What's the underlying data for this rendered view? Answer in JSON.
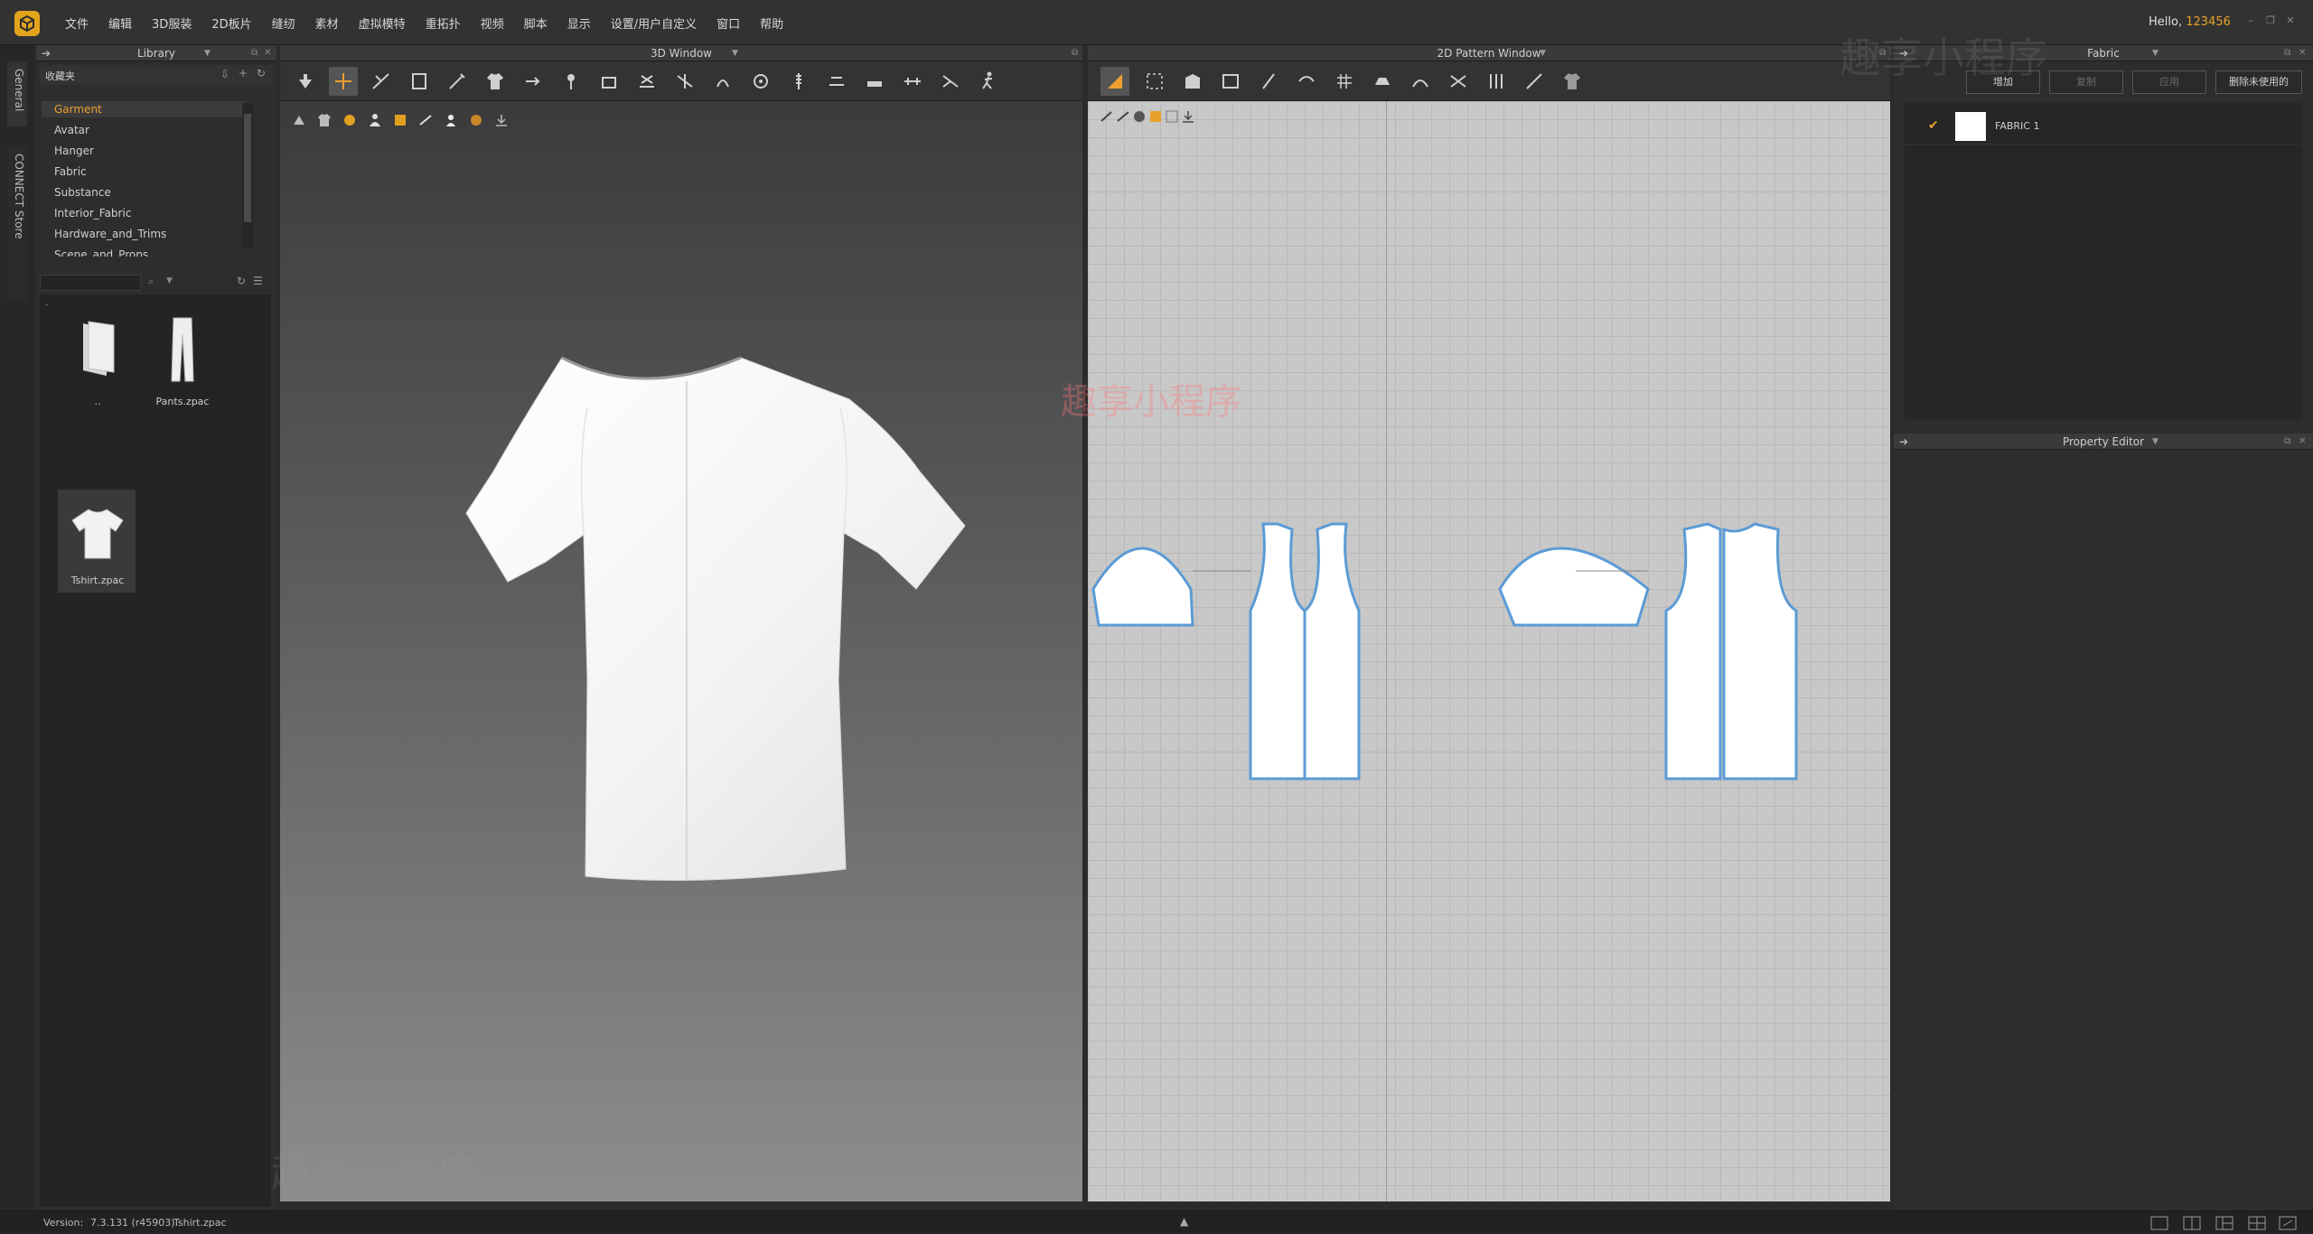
{
  "menubar": {
    "items": [
      "文件",
      "编辑",
      "3D服装",
      "2D板片",
      "缝纫",
      "素材",
      "虚拟模特",
      "重拓扑",
      "视频",
      "脚本",
      "显示",
      "设置/用户自定义",
      "窗口",
      "帮助"
    ],
    "hello": "Hello,",
    "username": "123456"
  },
  "left_tabs": [
    "General",
    "CONNECT Store"
  ],
  "library": {
    "title": "Library",
    "favorites": "收藏夹",
    "items": [
      "Garment",
      "Avatar",
      "Hanger",
      "Fabric",
      "Substance",
      "Interior_Fabric",
      "Hardware_and_Trims",
      "Scene_and_Props"
    ],
    "selected": "Garment",
    "search_placeholder": "",
    "path": ".",
    "files": [
      {
        "label": ".."
      },
      {
        "label": "Pants.zpac"
      },
      {
        "label": "Tshirt.zpac"
      }
    ]
  },
  "window3d": {
    "title": "3D Window"
  },
  "window2d": {
    "title": "2D Pattern Window"
  },
  "fabric": {
    "title": "Fabric",
    "buttons": [
      "增加",
      "复制",
      "应用",
      "删除未使用的"
    ],
    "items": [
      {
        "name": "FABRIC 1",
        "color": "#ffffff"
      }
    ]
  },
  "property_editor": {
    "title": "Property Editor"
  },
  "status": {
    "version_label": "Version:",
    "version": "7.3.131 (r45903)",
    "file": "Tshirt.zpac"
  },
  "watermark": "趣享小程序",
  "colors": {
    "accent": "#e8a22a",
    "selected_text": "#f0a030",
    "pattern_outline": "#5b9bd5"
  }
}
